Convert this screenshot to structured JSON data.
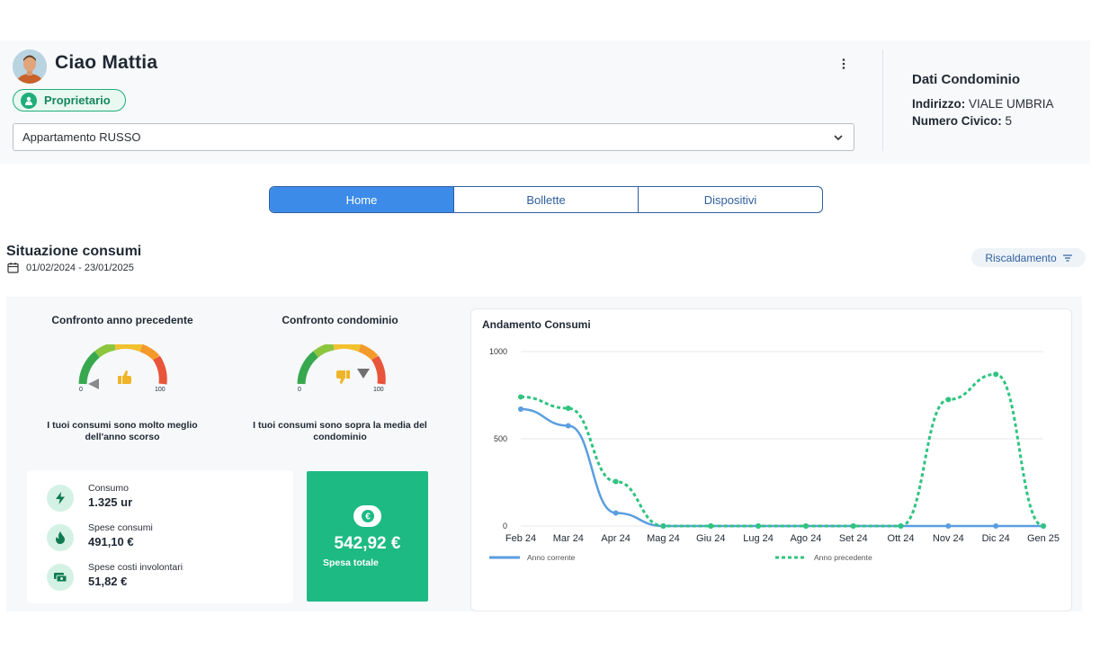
{
  "user": {
    "greeting": "Ciao Mattia",
    "role": "Proprietario",
    "apartment": "Appartamento RUSSO",
    "menu_icon": "kebab-menu-icon"
  },
  "condo": {
    "title": "Dati Condominio",
    "address_label": "Indirizzo:",
    "address_value": "VIALE UMBRIA",
    "number_label": "Numero Civico:",
    "number_value": "5"
  },
  "tabs": [
    {
      "label": "Home",
      "active": true
    },
    {
      "label": "Bollette",
      "active": false
    },
    {
      "label": "Dispositivi",
      "active": false
    }
  ],
  "consumi": {
    "title": "Situazione consumi",
    "date_range": "01/02/2024 - 23/01/2025",
    "filter": "Riscaldamento"
  },
  "gauges": [
    {
      "title": "Confronto anno precedente",
      "min": "0",
      "max": "100",
      "thumb": "thumbs-up",
      "text": "I tuoi consumi sono molto meglio dell'anno scorso"
    },
    {
      "title": "Confronto condominio",
      "min": "0",
      "max": "100",
      "thumb": "thumbs-down",
      "text": "I tuoi consumi sono sopra la media del condominio"
    }
  ],
  "stats": [
    {
      "label": "Consumo",
      "value": "1.325 ur",
      "icon": "lightning-icon"
    },
    {
      "label": "Spese consumi",
      "value": "491,10 €",
      "icon": "flame-icon"
    },
    {
      "label": "Spese costi involontari",
      "value": "51,82 €",
      "icon": "cash-icon"
    }
  ],
  "total": {
    "value": "542,92 €",
    "label": "Spesa totale",
    "icon": "euro-icon"
  },
  "colors": {
    "accent_blue": "#3d8be8",
    "accent_green": "#1dba84",
    "series_current": "#5b9ee0",
    "series_previous": "#2fc47f"
  },
  "chart_data": {
    "type": "line",
    "title": "Andamento Consumi",
    "categories": [
      "Feb 24",
      "Mar 24",
      "Apr 24",
      "Mag 24",
      "Giu 24",
      "Lug 24",
      "Ago 24",
      "Set 24",
      "Ott 24",
      "Nov 24",
      "Dic 24",
      "Gen 25"
    ],
    "yticks": [
      "0",
      "500",
      "1000"
    ],
    "ylim": [
      0,
      1000
    ],
    "series": [
      {
        "name": "Anno corrente",
        "style": "solid",
        "values": [
          670,
          575,
          75,
          0,
          0,
          0,
          0,
          0,
          0,
          0,
          0,
          0
        ]
      },
      {
        "name": "Anno precedente",
        "style": "dotted",
        "values": [
          740,
          675,
          255,
          0,
          0,
          0,
          0,
          0,
          0,
          725,
          870,
          0
        ]
      }
    ],
    "grid": true,
    "legend": "bottom"
  }
}
